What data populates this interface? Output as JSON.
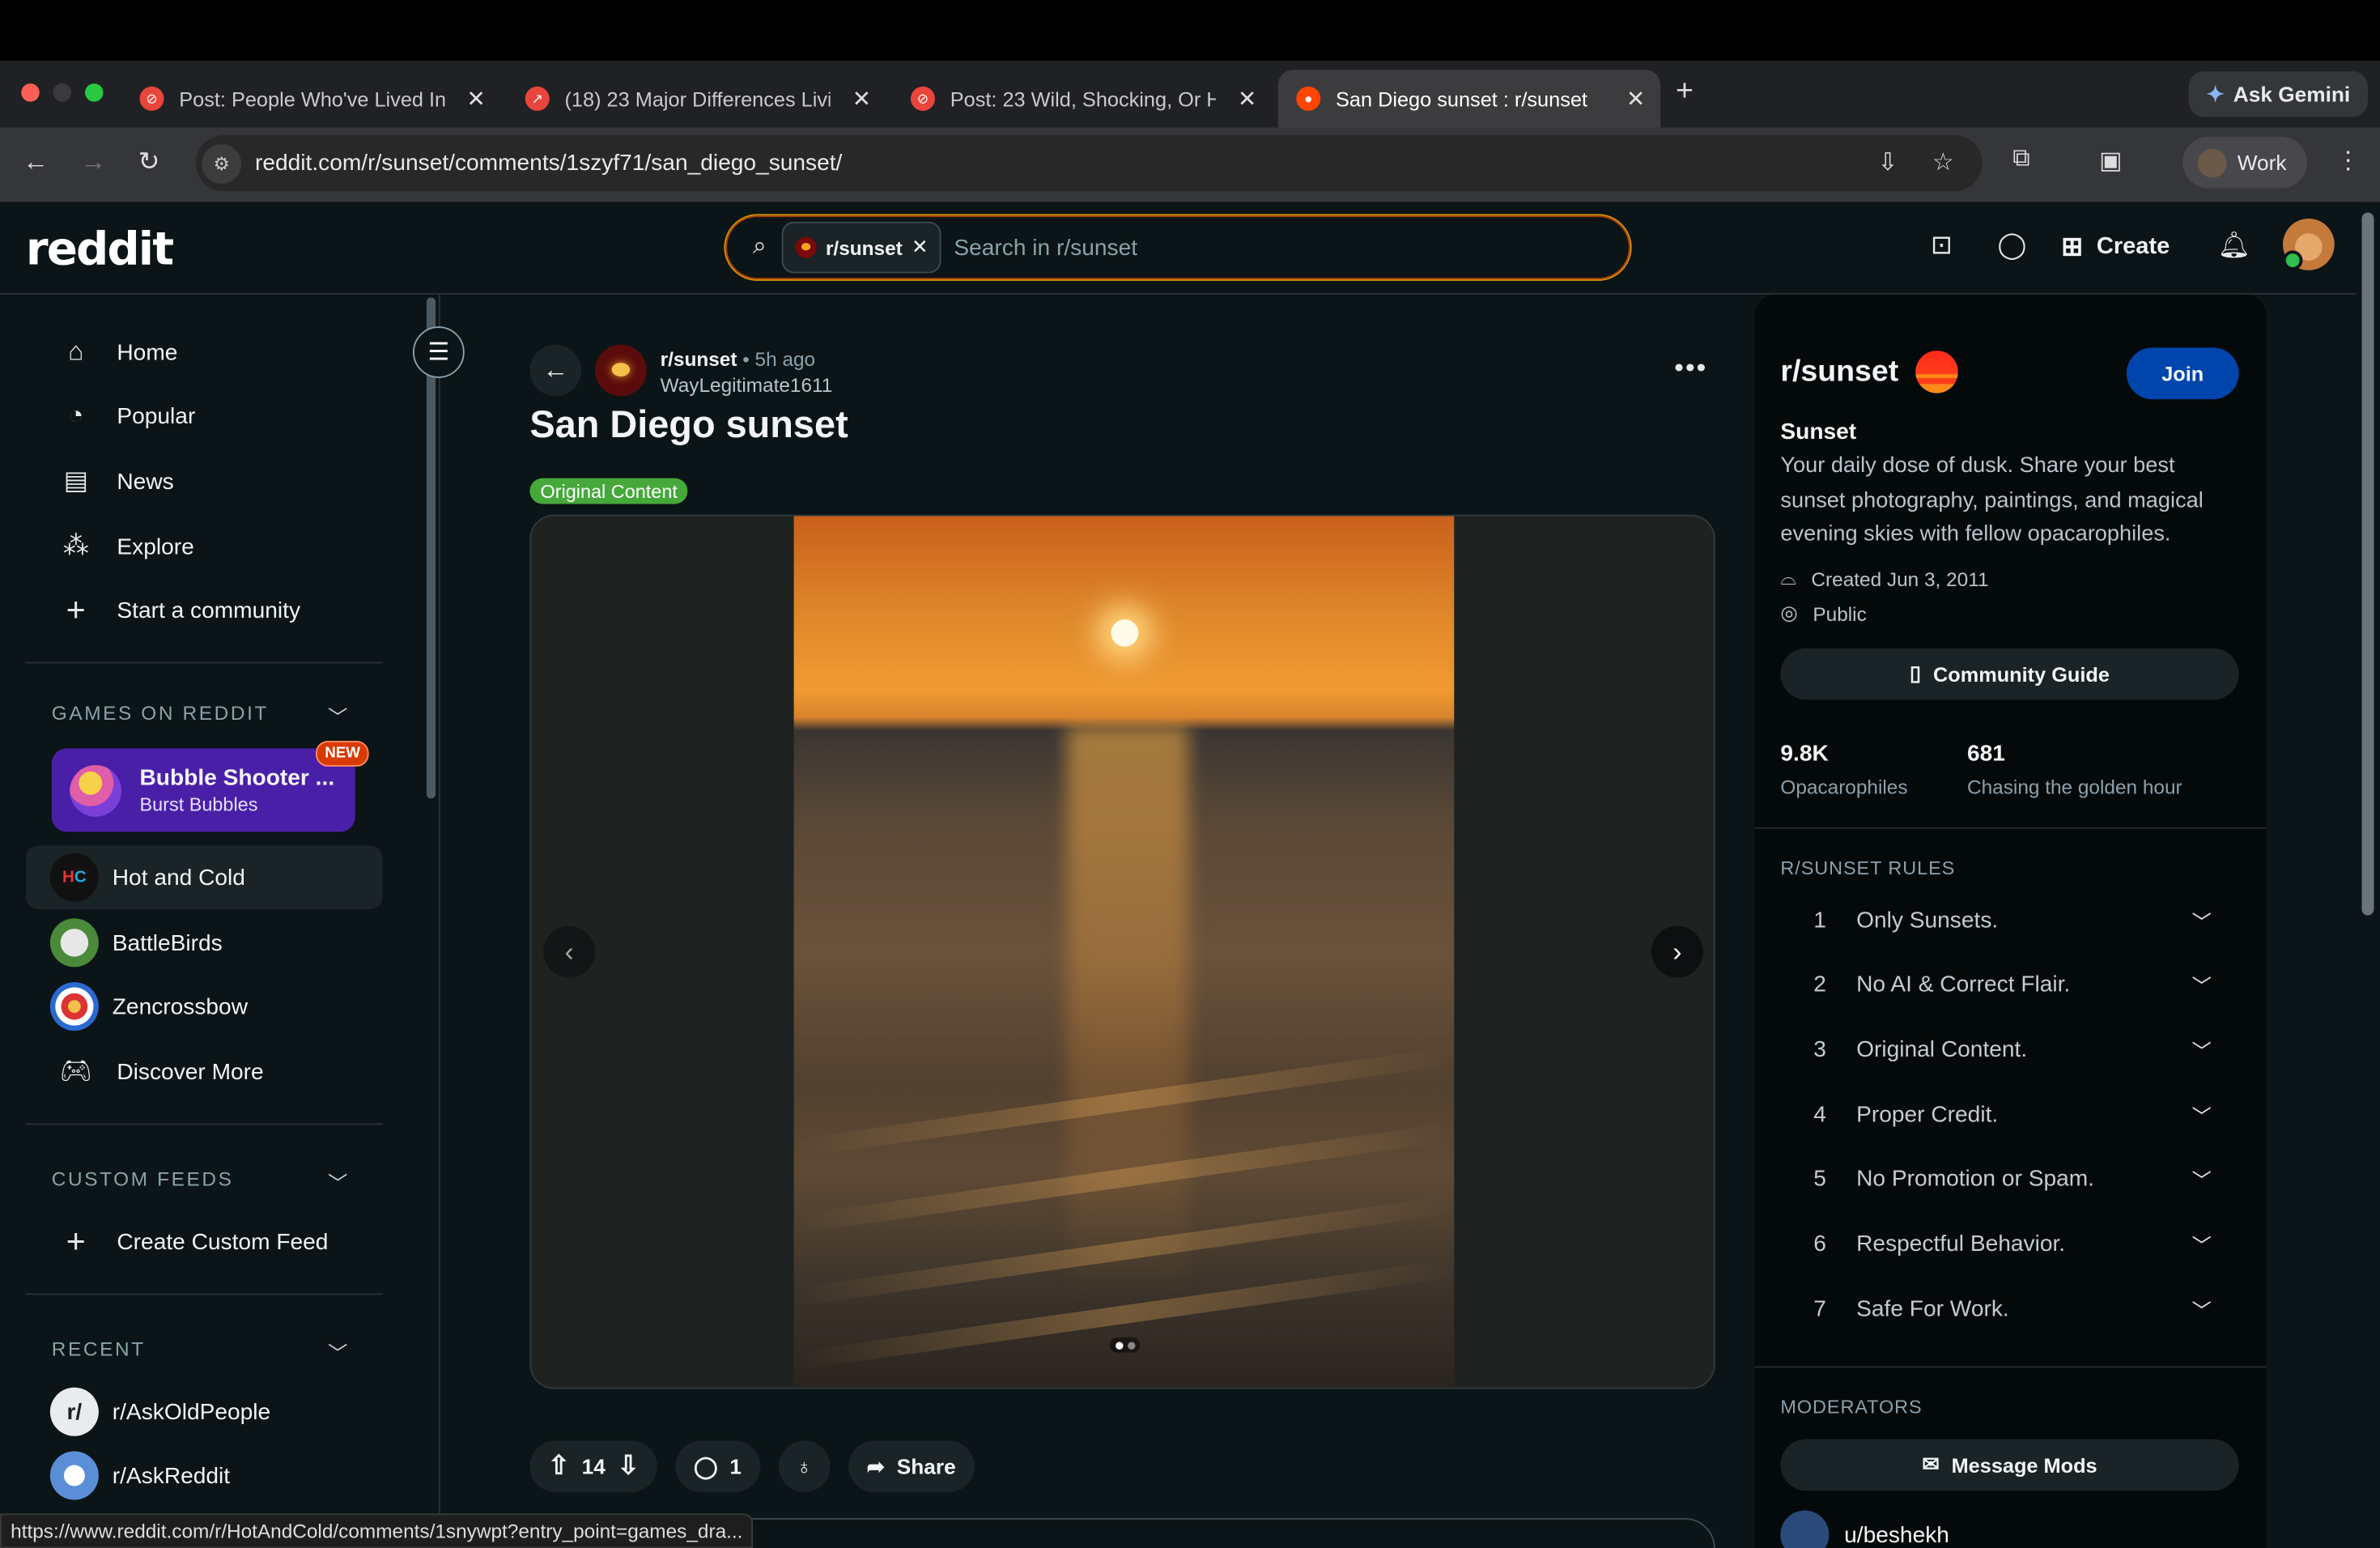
{
  "browser": {
    "tabs": [
      {
        "title": "Post: People Who've Lived In",
        "icon": "blocked-icon",
        "color": "#e8453c"
      },
      {
        "title": "(18) 23 Major Differences Livi",
        "icon": "trending-icon",
        "color": "#e8453c"
      },
      {
        "title": "Post: 23 Wild, Shocking, Or H",
        "icon": "blocked-icon",
        "color": "#e8453c"
      },
      {
        "title": "San Diego sunset : r/sunset",
        "icon": "reddit-icon",
        "color": "#ff4500"
      }
    ],
    "gemini_label": "Ask Gemini",
    "url": "reddit.com/r/sunset/comments/1szyf71/san_diego_sunset/",
    "profile_label": "Work",
    "status_url": "https://www.reddit.com/r/HotAndCold/comments/1snywpt?entry_point=games_dra..."
  },
  "header": {
    "logo": "reddit",
    "search_chip": "r/sunset",
    "search_placeholder": "Search in r/sunset",
    "create_label": "Create"
  },
  "sidebar": {
    "nav": [
      {
        "label": "Home",
        "icon": "home-icon",
        "glyph": "⌂"
      },
      {
        "label": "Popular",
        "icon": "popular-icon",
        "glyph": "◔"
      },
      {
        "label": "News",
        "icon": "news-icon",
        "glyph": "▤"
      },
      {
        "label": "Explore",
        "icon": "explore-icon",
        "glyph": "⁂"
      },
      {
        "label": "Start a community",
        "icon": "plus-icon",
        "glyph": "+"
      }
    ],
    "games_header": "GAMES ON REDDIT",
    "featured_game": {
      "title": "Bubble Shooter ...",
      "subtitle": "Burst Bubbles",
      "badge": "NEW"
    },
    "games": [
      {
        "label": "Hot and Cold"
      },
      {
        "label": "BattleBirds"
      },
      {
        "label": "Zencrossbow"
      },
      {
        "label": "Discover More"
      }
    ],
    "custom_feeds_header": "CUSTOM FEEDS",
    "create_feed": "Create Custom Feed",
    "recent_header": "RECENT",
    "recent": [
      {
        "label": "r/AskOldPeople"
      },
      {
        "label": "r/AskReddit"
      }
    ]
  },
  "post": {
    "subreddit": "r/sunset",
    "time": "• 5h ago",
    "author": "WayLegitimate1611",
    "title": "San Diego sunset",
    "flair": "Original Content",
    "votes": "14",
    "comments": "1",
    "share_label": "Share",
    "gallery_total": 2,
    "gallery_current": 1
  },
  "community": {
    "name": "r/sunset",
    "join_label": "Join",
    "title": "Sunset",
    "description": "Your daily dose of dusk. Share your best sunset photography, paintings, and magical evening skies with fellow opacarophiles.",
    "created": "Created Jun 3, 2011",
    "visibility": "Public",
    "guide_label": "Community Guide",
    "members_value": "9.8K",
    "members_label": "Opacarophiles",
    "online_value": "681",
    "online_label": "Chasing the golden hour",
    "rules_header": "R/SUNSET RULES",
    "rules": [
      {
        "n": "1",
        "text": "Only Sunsets."
      },
      {
        "n": "2",
        "text": "No AI & Correct Flair."
      },
      {
        "n": "3",
        "text": "Original Content."
      },
      {
        "n": "4",
        "text": "Proper Credit."
      },
      {
        "n": "5",
        "text": "No Promotion or Spam."
      },
      {
        "n": "6",
        "text": "Respectful Behavior."
      },
      {
        "n": "7",
        "text": "Safe For Work."
      }
    ],
    "moderators_header": "MODERATORS",
    "message_mods_label": "Message Mods",
    "moderator": "u/beshekh"
  }
}
